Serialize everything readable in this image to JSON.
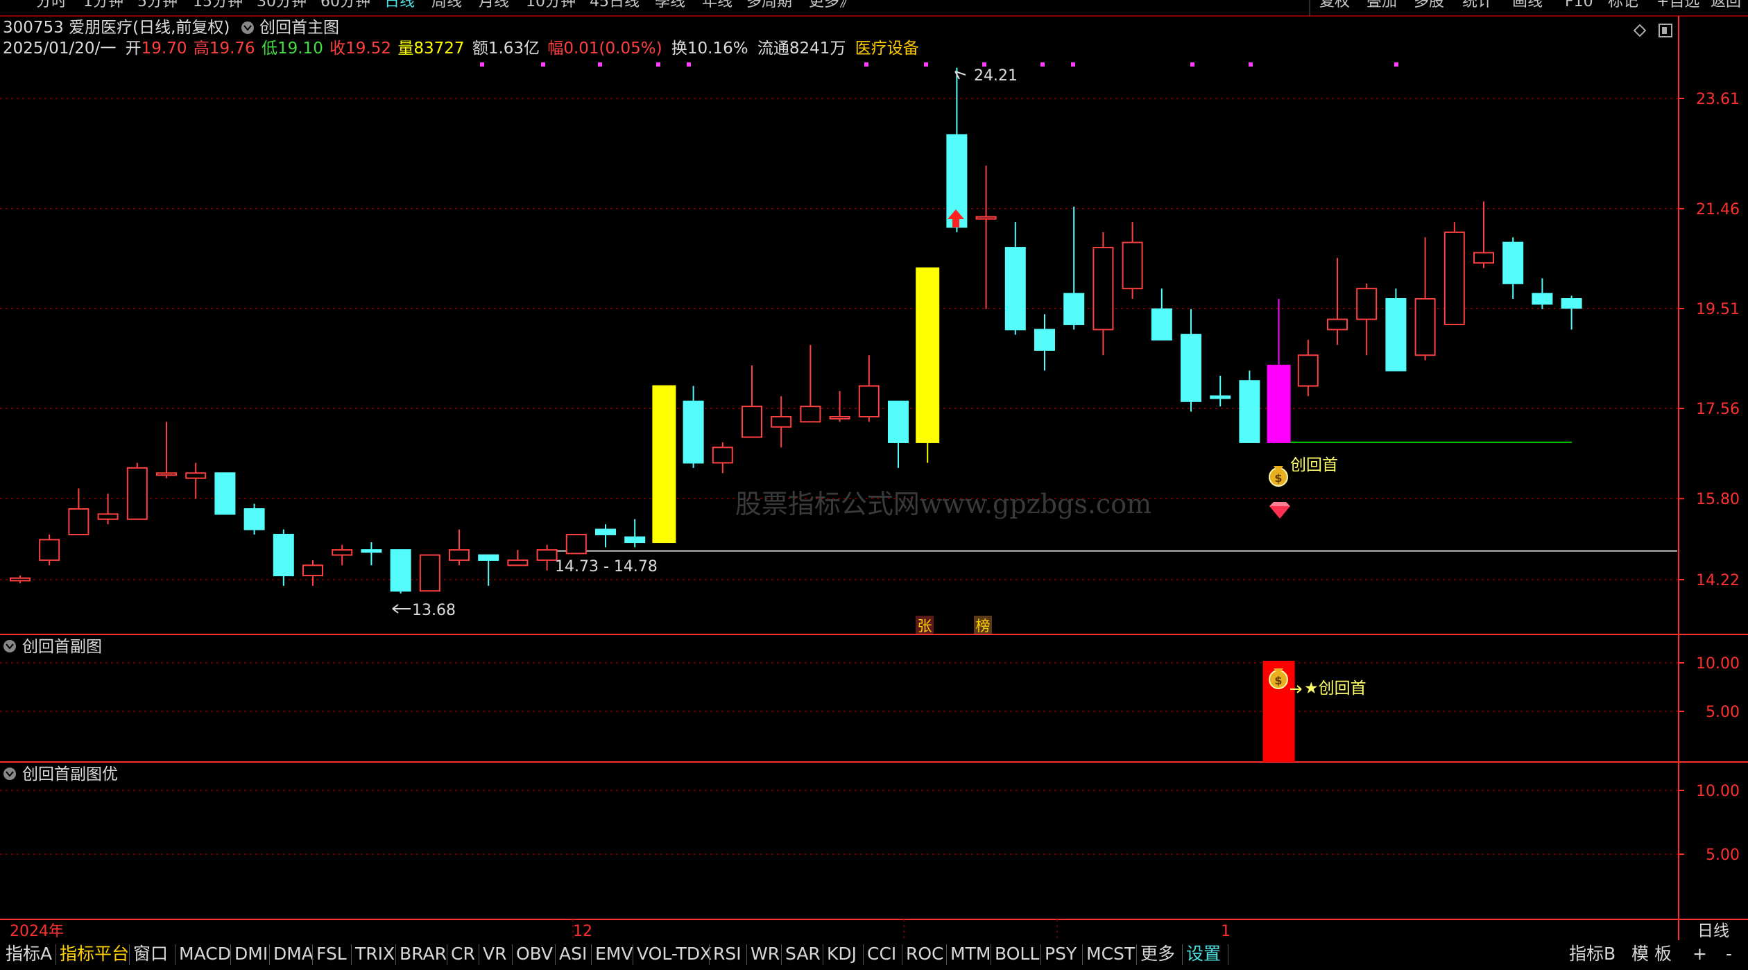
{
  "period_tabs": [
    {
      "label": "分时"
    },
    {
      "label": "1分钟"
    },
    {
      "label": "5分钟"
    },
    {
      "label": "15分钟"
    },
    {
      "label": "30分钟"
    },
    {
      "label": "60分钟"
    },
    {
      "label": "日线",
      "active": true
    },
    {
      "label": "周线"
    },
    {
      "label": "月线"
    },
    {
      "label": "10分钟"
    },
    {
      "label": "45日线"
    },
    {
      "label": "季线"
    },
    {
      "label": "年线"
    },
    {
      "label": "多周期"
    },
    {
      "label": "更多》"
    }
  ],
  "right_tabs": [
    {
      "label": "复权"
    },
    {
      "label": "叠加"
    },
    {
      "label": "多股"
    },
    {
      "label": "统计"
    },
    {
      "label": "画线"
    },
    {
      "label": "F10"
    },
    {
      "label": "标记"
    },
    {
      "label": "+自选"
    },
    {
      "label": "返回"
    }
  ],
  "header": {
    "stock_title": "300753 爱朋医疗(日线,前复权)",
    "indicator_title": "创回首主图",
    "date": "2025/01/20/一",
    "open_label": "开",
    "open": "19.70",
    "high_label": "高",
    "high": "19.76",
    "low_label": "低",
    "low": "19.10",
    "close_label": "收",
    "close": "19.52",
    "volume_label": "量",
    "volume": "83727",
    "amount_label": "额",
    "amount": "1.63亿",
    "change_label": "幅",
    "change": "0.01(0.05%)",
    "turnover_label": "换",
    "turnover": "10.16%",
    "float_label": "流通",
    "float_shares": "8241万",
    "sector": "医疗设备"
  },
  "colors": {
    "up": "#ff4040",
    "down": "#54fcfc",
    "signal_yellow": "#ffff00",
    "signal_magenta": "#ff00ff",
    "grid": "#8b0000",
    "axis": "#ff3030",
    "support": "#00cc00",
    "label_yellow": "#ffff66",
    "pink_dot": "#ff40ff"
  },
  "watermark": "股票指标公式网www.gpzbgs.com",
  "annotations": {
    "max_label": "24.21",
    "min_label": "13.68",
    "range_label": "14.73 - 14.78",
    "signal_label": "创回首",
    "sub_signal_label": "★创回首",
    "badge_zhang": "张",
    "badge_bang": "榜"
  },
  "panels": {
    "sub1_title": "创回首副图",
    "sub2_title": "创回首副图优"
  },
  "x_axis": {
    "labels": [
      "2024年",
      "12",
      "1"
    ],
    "period": "日线"
  },
  "bottom_tabs": [
    {
      "label": "指标A"
    },
    {
      "label": "指标平台",
      "highlight": true
    },
    {
      "label": "窗口"
    },
    {
      "label": "MACD"
    },
    {
      "label": "DMI"
    },
    {
      "label": "DMA"
    },
    {
      "label": "FSL"
    },
    {
      "label": "TRIX"
    },
    {
      "label": "BRAR"
    },
    {
      "label": "CR"
    },
    {
      "label": "VR"
    },
    {
      "label": "OBV"
    },
    {
      "label": "ASI"
    },
    {
      "label": "EMV"
    },
    {
      "label": "VOL-TDX"
    },
    {
      "label": "RSI"
    },
    {
      "label": "WR"
    },
    {
      "label": "SAR"
    },
    {
      "label": "KDJ"
    },
    {
      "label": "CCI"
    },
    {
      "label": "ROC"
    },
    {
      "label": "MTM"
    },
    {
      "label": "BOLL"
    },
    {
      "label": "PSY"
    },
    {
      "label": "MCST"
    },
    {
      "label": "更多"
    },
    {
      "label": "设置",
      "setting": true
    }
  ],
  "bottom_right_tabs": [
    {
      "label": "指标B"
    },
    {
      "label": "模 板"
    },
    {
      "label": "+"
    },
    {
      "label": "-"
    }
  ],
  "chart_data": [
    {
      "type": "candlestick",
      "title": "创回首主图",
      "ylim": [
        13.0,
        25.6
      ],
      "y_ticks": [
        "23.61",
        "21.46",
        "19.51",
        "17.56",
        "15.80",
        "14.22"
      ],
      "candles": [
        {
          "o": 14.2,
          "h": 14.3,
          "l": 14.15,
          "c": 14.25,
          "dir": "up"
        },
        {
          "o": 14.6,
          "h": 15.1,
          "l": 14.5,
          "c": 15.0,
          "dir": "up"
        },
        {
          "o": 15.1,
          "h": 16.0,
          "l": 15.1,
          "c": 15.6,
          "dir": "up"
        },
        {
          "o": 15.4,
          "h": 15.9,
          "l": 15.3,
          "c": 15.5,
          "dir": "up"
        },
        {
          "o": 15.4,
          "h": 16.5,
          "l": 15.4,
          "c": 16.4,
          "dir": "up"
        },
        {
          "o": 16.3,
          "h": 17.3,
          "l": 16.2,
          "c": 16.3,
          "dir": "up"
        },
        {
          "o": 16.2,
          "h": 16.5,
          "l": 15.8,
          "c": 16.3,
          "dir": "up"
        },
        {
          "o": 16.3,
          "h": 16.3,
          "l": 15.5,
          "c": 15.5,
          "dir": "down"
        },
        {
          "o": 15.6,
          "h": 15.7,
          "l": 15.1,
          "c": 15.2,
          "dir": "down"
        },
        {
          "o": 15.1,
          "h": 15.2,
          "l": 14.1,
          "c": 14.3,
          "dir": "down"
        },
        {
          "o": 14.3,
          "h": 14.6,
          "l": 14.1,
          "c": 14.5,
          "dir": "up"
        },
        {
          "o": 14.7,
          "h": 14.9,
          "l": 14.5,
          "c": 14.8,
          "dir": "up"
        },
        {
          "o": 14.8,
          "h": 14.95,
          "l": 14.5,
          "c": 14.8,
          "dir": "down"
        },
        {
          "o": 14.8,
          "h": 14.8,
          "l": 13.95,
          "c": 14.0,
          "dir": "down"
        },
        {
          "o": 14.0,
          "h": 14.7,
          "l": 14.0,
          "c": 14.7,
          "dir": "up"
        },
        {
          "o": 14.6,
          "h": 15.2,
          "l": 14.5,
          "c": 14.8,
          "dir": "up"
        },
        {
          "o": 14.7,
          "h": 14.7,
          "l": 14.1,
          "c": 14.6,
          "dir": "down"
        },
        {
          "o": 14.5,
          "h": 14.8,
          "l": 14.5,
          "c": 14.6,
          "dir": "up"
        },
        {
          "o": 14.6,
          "h": 14.9,
          "l": 14.4,
          "c": 14.8,
          "dir": "up"
        },
        {
          "o": 14.73,
          "h": 15.1,
          "l": 14.73,
          "c": 15.1,
          "dir": "up"
        },
        {
          "o": 15.2,
          "h": 15.3,
          "l": 14.85,
          "c": 15.1,
          "dir": "down"
        },
        {
          "o": 15.05,
          "h": 15.4,
          "l": 14.85,
          "c": 14.95,
          "dir": "down"
        },
        {
          "o": 14.95,
          "h": 18.0,
          "l": 14.95,
          "c": 18.0,
          "dir": "up",
          "signal": "yellow"
        },
        {
          "o": 17.7,
          "h": 18.0,
          "l": 16.4,
          "c": 16.5,
          "dir": "down"
        },
        {
          "o": 16.5,
          "h": 16.9,
          "l": 16.3,
          "c": 16.8,
          "dir": "up"
        },
        {
          "o": 17.0,
          "h": 18.4,
          "l": 17.0,
          "c": 17.6,
          "dir": "up"
        },
        {
          "o": 17.2,
          "h": 17.8,
          "l": 16.8,
          "c": 17.4,
          "dir": "up"
        },
        {
          "o": 17.3,
          "h": 18.8,
          "l": 17.3,
          "c": 17.6,
          "dir": "up"
        },
        {
          "o": 17.4,
          "h": 17.9,
          "l": 17.3,
          "c": 17.4,
          "dir": "up"
        },
        {
          "o": 17.4,
          "h": 18.6,
          "l": 17.3,
          "c": 18.0,
          "dir": "up"
        },
        {
          "o": 17.7,
          "h": 17.7,
          "l": 16.4,
          "c": 16.9,
          "dir": "down"
        },
        {
          "o": 16.9,
          "h": 20.3,
          "l": 16.5,
          "c": 20.3,
          "dir": "up",
          "signal": "yellow"
        },
        {
          "o": 22.9,
          "h": 24.21,
          "l": 21.0,
          "c": 21.1,
          "dir": "down"
        },
        {
          "o": 21.3,
          "h": 22.3,
          "l": 19.5,
          "c": 21.3,
          "dir": "up"
        },
        {
          "o": 20.7,
          "h": 21.2,
          "l": 19.0,
          "c": 19.1,
          "dir": "down"
        },
        {
          "o": 19.1,
          "h": 19.4,
          "l": 18.3,
          "c": 18.7,
          "dir": "down"
        },
        {
          "o": 19.8,
          "h": 21.5,
          "l": 19.1,
          "c": 19.2,
          "dir": "down"
        },
        {
          "o": 19.1,
          "h": 21.0,
          "l": 18.6,
          "c": 20.7,
          "dir": "up"
        },
        {
          "o": 19.9,
          "h": 21.2,
          "l": 19.7,
          "c": 20.8,
          "dir": "up"
        },
        {
          "o": 19.5,
          "h": 19.9,
          "l": 18.9,
          "c": 18.9,
          "dir": "down"
        },
        {
          "o": 19.0,
          "h": 19.5,
          "l": 17.5,
          "c": 17.7,
          "dir": "down"
        },
        {
          "o": 17.8,
          "h": 18.2,
          "l": 17.6,
          "c": 17.8,
          "dir": "down"
        },
        {
          "o": 18.1,
          "h": 18.3,
          "l": 16.9,
          "c": 16.9,
          "dir": "down"
        },
        {
          "o": 16.9,
          "h": 19.7,
          "l": 16.9,
          "c": 18.4,
          "dir": "up",
          "signal": "magenta"
        },
        {
          "o": 18.0,
          "h": 18.9,
          "l": 17.8,
          "c": 18.6,
          "dir": "up"
        },
        {
          "o": 19.1,
          "h": 20.5,
          "l": 18.8,
          "c": 19.3,
          "dir": "up"
        },
        {
          "o": 19.3,
          "h": 20.0,
          "l": 18.6,
          "c": 19.9,
          "dir": "up"
        },
        {
          "o": 19.7,
          "h": 19.9,
          "l": 18.3,
          "c": 18.3,
          "dir": "down"
        },
        {
          "o": 18.6,
          "h": 20.9,
          "l": 18.5,
          "c": 19.7,
          "dir": "up"
        },
        {
          "o": 19.2,
          "h": 21.2,
          "l": 19.2,
          "c": 21.0,
          "dir": "up"
        },
        {
          "o": 20.4,
          "h": 21.6,
          "l": 20.3,
          "c": 20.6,
          "dir": "up"
        },
        {
          "o": 20.8,
          "h": 20.9,
          "l": 19.7,
          "c": 20.0,
          "dir": "down"
        },
        {
          "o": 19.8,
          "h": 20.1,
          "l": 19.5,
          "c": 19.6,
          "dir": "down"
        },
        {
          "o": 19.7,
          "h": 19.76,
          "l": 19.1,
          "c": 19.52,
          "dir": "down"
        }
      ],
      "support_lines": [
        {
          "y": 14.78,
          "from_index": 19,
          "to_index": 57,
          "color": "white"
        },
        {
          "y": 16.9,
          "from_index": 43,
          "to_index": 53,
          "color": "green"
        }
      ],
      "top_marks_index": [
        16,
        20,
        22,
        23,
        29,
        31,
        35,
        36,
        40,
        42,
        47
      ]
    },
    {
      "type": "bar",
      "title": "创回首副图",
      "ylim": [
        0,
        12.0
      ],
      "y_ticks": [
        "10.00",
        "5.00"
      ],
      "bars": [
        {
          "index": 43,
          "value": 10.0,
          "color": "red"
        }
      ]
    },
    {
      "type": "bar",
      "title": "创回首副图优",
      "ylim": [
        0,
        13.0
      ],
      "y_ticks": [
        "10.00",
        "5.00"
      ],
      "bars": []
    }
  ]
}
